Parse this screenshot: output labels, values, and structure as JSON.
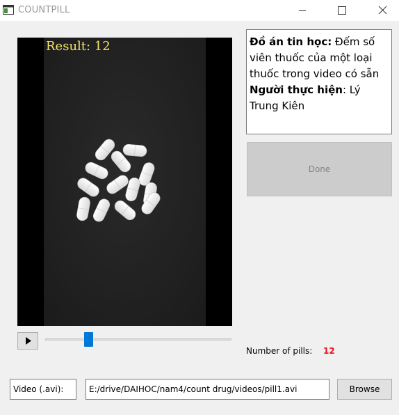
{
  "window": {
    "title": "COUNTPILL",
    "icons": {
      "app": "app-window-icon",
      "minimize": "minimize-icon",
      "maximize": "maximize-icon",
      "close": "close-icon"
    }
  },
  "video": {
    "result_text": "Result: 12"
  },
  "player": {
    "play_icon": "play-icon",
    "slider_position": 0.22
  },
  "info": {
    "project_label": "Đồ án tin học:",
    "project_text": " Đếm số viên thuốc của một loại thuốc trong video có sẵn",
    "author_label": "Người thực hiện",
    "author_text": ": Lý Trung Kiên"
  },
  "done_button": {
    "label": "Done"
  },
  "pills": {
    "label": "Number of pills:",
    "value": "12"
  },
  "file": {
    "label": "Video (.avi):",
    "path": "E:/drive/DAIHOC/nam4/count drug/videos/pill1.avi",
    "browse_label": "Browse"
  },
  "colors": {
    "accent": "#0078d7",
    "count": "#e81123",
    "result_overlay": "#f2e36a"
  }
}
